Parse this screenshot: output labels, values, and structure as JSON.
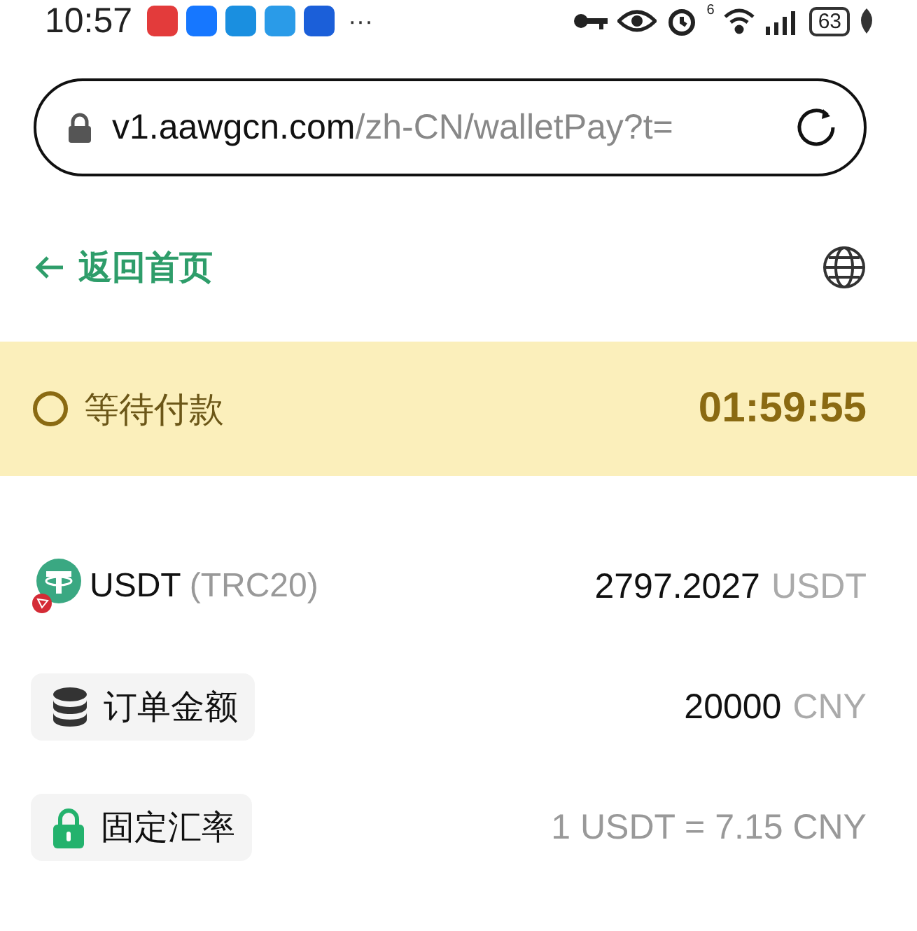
{
  "status_bar": {
    "time": "10:57",
    "more": "···",
    "wifi_badge": "6",
    "battery": "63"
  },
  "address_bar": {
    "host": "v1.aawgcn.com",
    "path": "/zh-CN/walletPay?t="
  },
  "nav": {
    "back_label": "返回首页"
  },
  "payment_status": {
    "label": "等待付款",
    "timer": "01:59:55"
  },
  "rows": [
    {
      "kind": "coin",
      "label": "USDT",
      "sublabel": "(TRC20)",
      "value": "2797.2027",
      "unit": "USDT"
    },
    {
      "kind": "amount",
      "label": "订单金额",
      "value": "20000",
      "unit": "CNY"
    },
    {
      "kind": "rate",
      "label": "固定汇率",
      "value": "1 USDT = 7.15 CNY"
    }
  ]
}
